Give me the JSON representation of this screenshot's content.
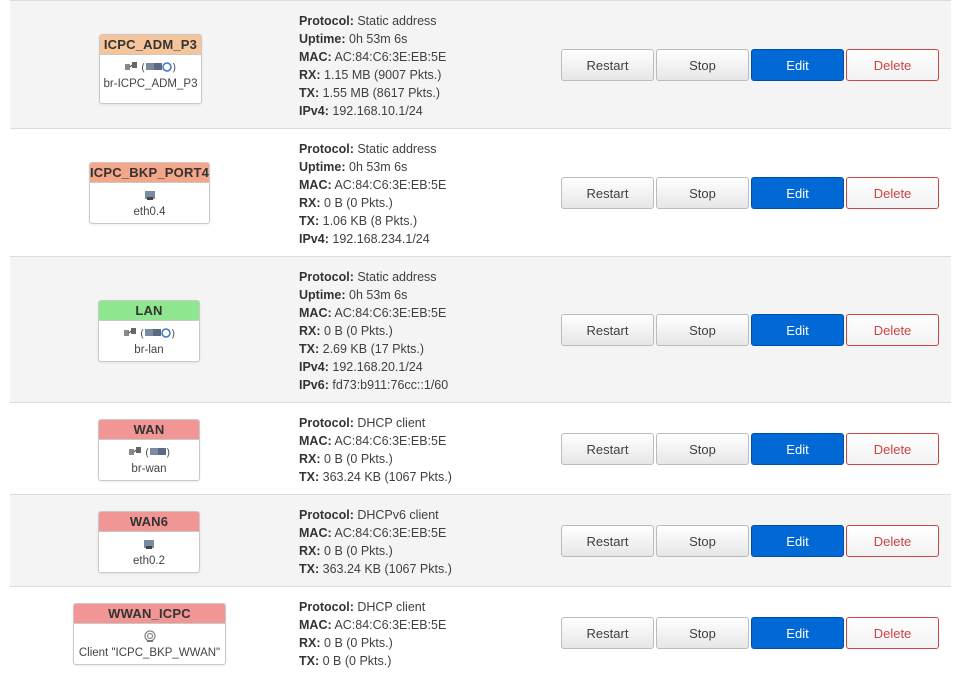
{
  "labels": {
    "protocol": "Protocol:",
    "uptime": "Uptime:",
    "mac": "MAC:",
    "rx": "RX:",
    "tx": "TX:",
    "ipv4": "IPv4:",
    "ipv6": "IPv6:"
  },
  "buttons": {
    "restart": "Restart",
    "stop": "Stop",
    "edit": "Edit",
    "delete": "Delete"
  },
  "interfaces": [
    {
      "name": "ICPC_ADM_P3",
      "color": "#f5c49a",
      "device": "br-ICPC_ADM_P3",
      "icons": [
        "bridge-icon",
        "ethernet-wifi-group-icon"
      ],
      "protocol": "Static address",
      "uptime": "0h 53m 6s",
      "mac": "AC:84:C6:3E:EB:5E",
      "rx": "1.15 MB (9007 Pkts.)",
      "tx": "1.55 MB (8617 Pkts.)",
      "ipv4": "192.168.10.1/24"
    },
    {
      "name": "ICPC_BKP_PORT4",
      "color": "#f3a68a",
      "device": "eth0.4",
      "icons": [
        "ethernet-port-icon"
      ],
      "protocol": "Static address",
      "uptime": "0h 53m 6s",
      "mac": "AC:84:C6:3E:EB:5E",
      "rx": "0 B (0 Pkts.)",
      "tx": "1.06 KB (8 Pkts.)",
      "ipv4": "192.168.234.1/24"
    },
    {
      "name": "LAN",
      "color": "#8ee68e",
      "device": "br-lan",
      "icons": [
        "bridge-icon",
        "ethernet-wifi-group-icon"
      ],
      "protocol": "Static address",
      "uptime": "0h 53m 6s",
      "mac": "AC:84:C6:3E:EB:5E",
      "rx": "0 B (0 Pkts.)",
      "tx": "2.69 KB (17 Pkts.)",
      "ipv4": "192.168.20.1/24",
      "ipv6": "fd73:b911:76cc::1/60"
    },
    {
      "name": "WAN",
      "color": "#f19595",
      "device": "br-wan",
      "icons": [
        "bridge-icon",
        "ethernet-group-icon"
      ],
      "protocol": "DHCP client",
      "mac": "AC:84:C6:3E:EB:5E",
      "rx": "0 B (0 Pkts.)",
      "tx": "363.24 KB (1067 Pkts.)"
    },
    {
      "name": "WAN6",
      "color": "#f19595",
      "device": "eth0.2",
      "icons": [
        "ethernet-port-icon"
      ],
      "protocol": "DHCPv6 client",
      "mac": "AC:84:C6:3E:EB:5E",
      "rx": "0 B (0 Pkts.)",
      "tx": "363.24 KB (1067 Pkts.)"
    },
    {
      "name": "WWAN_ICPC",
      "color": "#f19595",
      "device": "Client \"ICPC_BKP_WWAN\"",
      "icons": [
        "wifi-icon"
      ],
      "protocol": "DHCP client",
      "mac": "AC:84:C6:3E:EB:5E",
      "rx": "0 B (0 Pkts.)",
      "tx": "0 B (0 Pkts.)"
    }
  ]
}
